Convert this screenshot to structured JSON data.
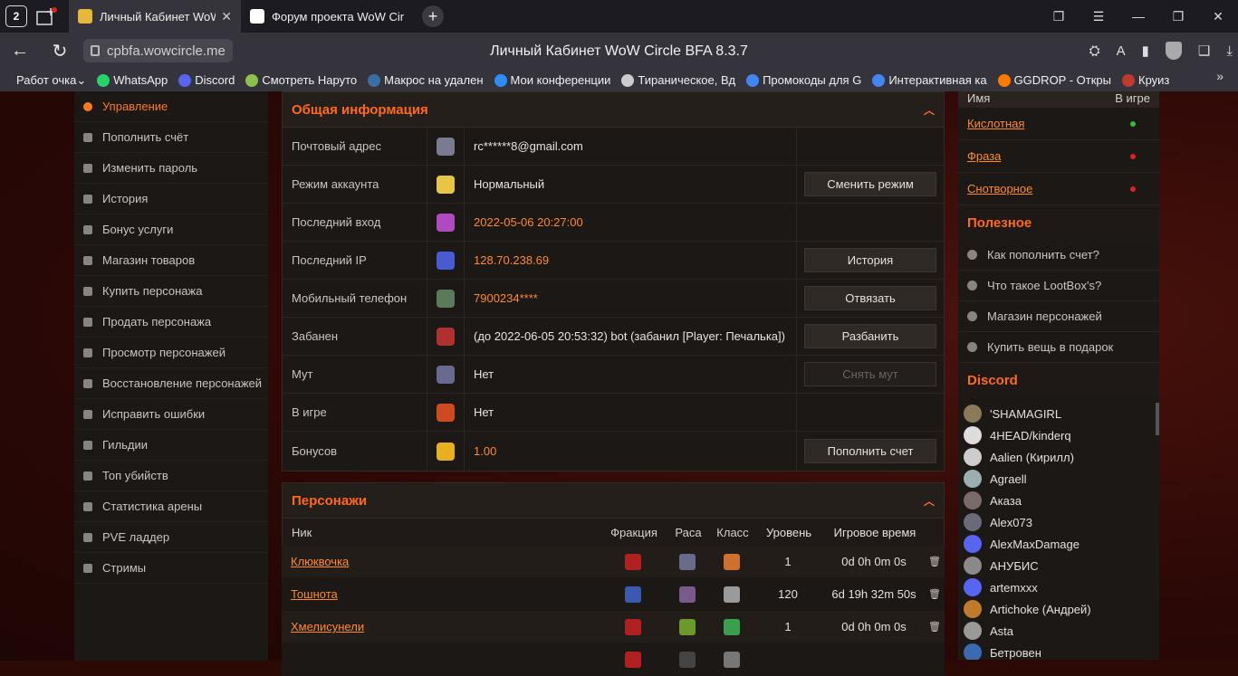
{
  "browser": {
    "tab_count": "2",
    "tabs": [
      {
        "label": "Личный Кабинет WoW",
        "icon_color": "#e6b73a"
      },
      {
        "label": "Форум проекта WoW Circ",
        "icon_color": "#ffffff"
      }
    ],
    "url": "cpbfa.wowcircle.me",
    "page_title": "Личный Кабинет WoW Circle BFA 8.3.7",
    "bookmarks": [
      {
        "label": "Работ очка",
        "icon": "none"
      },
      {
        "label": "WhatsApp",
        "icon": "whatsapp-icon",
        "color": "#25d366"
      },
      {
        "label": "Discord",
        "icon": "discord-icon",
        "color": "#5865f2"
      },
      {
        "label": "Смотреть Наруто",
        "icon": "naruto-icon",
        "color": "#8bc34a"
      },
      {
        "label": "Макрос на удален",
        "icon": "macro-icon",
        "color": "#3a6ea5"
      },
      {
        "label": "Мои конференции",
        "icon": "zoom-icon",
        "color": "#2d8cff"
      },
      {
        "label": "Тираническое, Вд",
        "icon": "mplus-icon",
        "color": "#cccccc"
      },
      {
        "label": "Промокоды для G",
        "icon": "google-icon",
        "color": "#4285f4"
      },
      {
        "label": "Интерактивная ка",
        "icon": "google-icon",
        "color": "#4285f4"
      },
      {
        "label": "GGDROP - Откры",
        "icon": "ggdrop-icon",
        "color": "#ff7a00"
      },
      {
        "label": "Круиз",
        "icon": "cruise-icon",
        "color": "#c0392b"
      }
    ]
  },
  "sidebar": {
    "items": [
      {
        "label": "Управление",
        "icon": "gear-icon",
        "active": true
      },
      {
        "label": "Пополнить счёт",
        "icon": "plus-circle-icon"
      },
      {
        "label": "Изменить пароль",
        "icon": "lock-icon"
      },
      {
        "label": "История",
        "icon": "history-icon"
      },
      {
        "label": "Бонус услуги",
        "icon": "gift-icon"
      },
      {
        "label": "Магазин товаров",
        "icon": "cart-icon"
      },
      {
        "label": "Купить персонажа",
        "icon": "user-icon"
      },
      {
        "label": "Продать персонажа",
        "icon": "user-icon"
      },
      {
        "label": "Просмотр персонажей",
        "icon": "male-icon"
      },
      {
        "label": "Восстановление персонажей",
        "icon": "male-icon"
      },
      {
        "label": "Исправить ошибки",
        "icon": "shield-icon"
      },
      {
        "label": "Гильдии",
        "icon": "users-icon"
      },
      {
        "label": "Топ убийств",
        "icon": "chart-icon"
      },
      {
        "label": "Статистика арены",
        "icon": "chart-icon"
      },
      {
        "label": "PVE ладдер",
        "icon": "chart-icon"
      },
      {
        "label": "Стримы",
        "icon": "twitch-icon"
      }
    ]
  },
  "general": {
    "title": "Общая информация",
    "rows": [
      {
        "label": "Почтовый адрес",
        "value": "rc******8@gmail.com",
        "orange": false,
        "icon_color": "#7a7a90",
        "action": ""
      },
      {
        "label": "Режим аккаунта",
        "value": "Нормальный",
        "orange": false,
        "icon_color": "#e8c547",
        "action": "Сменить режим"
      },
      {
        "label": "Последний вход",
        "value": "2022-05-06 20:27:00",
        "orange": true,
        "icon_color": "#b04ac0",
        "action": ""
      },
      {
        "label": "Последний IP",
        "value": "128.70.238.69",
        "orange": true,
        "icon_color": "#4a5ad0",
        "action": "История"
      },
      {
        "label": "Мобильный телефон",
        "value": "7900234****",
        "orange": true,
        "icon_color": "#5a7a5a",
        "action": "Отвязать"
      },
      {
        "label": "Забанен",
        "value": "(до 2022-06-05 20:53:32) bot (забанил [Player: Печалька])",
        "orange": false,
        "icon_color": "#b03030",
        "action": "Разбанить"
      },
      {
        "label": "Мут",
        "value": "Нет",
        "orange": false,
        "icon_color": "#6a6a90",
        "action": "Снять мут",
        "disabled": true
      },
      {
        "label": "В игре",
        "value": "Нет",
        "orange": false,
        "icon_color": "#d04a20",
        "action": ""
      },
      {
        "label": "Бонусов",
        "value": "1.00",
        "orange": true,
        "icon_color": "#e8b020",
        "action": "Пополнить счет"
      }
    ]
  },
  "characters": {
    "title": "Персонажи",
    "columns": [
      "Ник",
      "Фракция",
      "Раса",
      "Класс",
      "Уровень",
      "Игровое время"
    ],
    "rows": [
      {
        "name": "Клюквочка",
        "level": "1",
        "time": "0d 0h 0m 0s",
        "fac": "#b02020",
        "race": "#6a6a8a",
        "cls": "#d0702a"
      },
      {
        "name": "Тошнота",
        "level": "120",
        "time": "6d 19h 32m 50s",
        "fac": "#3a5ab0",
        "race": "#7a5a8a",
        "cls": "#9a9a9a"
      },
      {
        "name": "Хмелисунели",
        "level": "1",
        "time": "0d 0h 0m 0s",
        "fac": "#b02020",
        "race": "#6a9a2a",
        "cls": "#3aa050"
      },
      {
        "name": "",
        "level": "",
        "time": "",
        "fac": "#b02020",
        "race": "#444",
        "cls": "#777"
      }
    ]
  },
  "online": {
    "col_name": "Имя",
    "col_status": "В игре",
    "rows": [
      {
        "name": "Кислотная",
        "color": "#2ec02e"
      },
      {
        "name": "Фраза",
        "color": "#e02020"
      },
      {
        "name": "Снотворное",
        "color": "#e02020"
      }
    ]
  },
  "useful": {
    "title": "Полезное",
    "items": [
      "Как пополнить счет?",
      "Что такое LootBox's?",
      "Магазин персонажей",
      "Купить вещь в подарок"
    ]
  },
  "discord": {
    "title": "Discord",
    "members": [
      {
        "name": "'SHAMAGIRL",
        "color": "#8a7a5a"
      },
      {
        "name": "4HEAD/kinderq",
        "color": "#dddddd"
      },
      {
        "name": "Aalien (Кирилл)",
        "color": "#cccccc"
      },
      {
        "name": "Agraell",
        "color": "#9ab0b0"
      },
      {
        "name": "Аказа",
        "color": "#7a6a6a"
      },
      {
        "name": "Alex073",
        "color": "#6a6a7a"
      },
      {
        "name": "AlexMaxDamage",
        "color": "#5865f2"
      },
      {
        "name": "АНУБИС",
        "color": "#8a8a8a"
      },
      {
        "name": "artemxxx",
        "color": "#5865f2"
      },
      {
        "name": "Artichoke (Андрей)",
        "color": "#c07a2a"
      },
      {
        "name": "Asta",
        "color": "#9a9a9a"
      },
      {
        "name": "Бетровен",
        "color": "#3a6ab0"
      }
    ]
  }
}
